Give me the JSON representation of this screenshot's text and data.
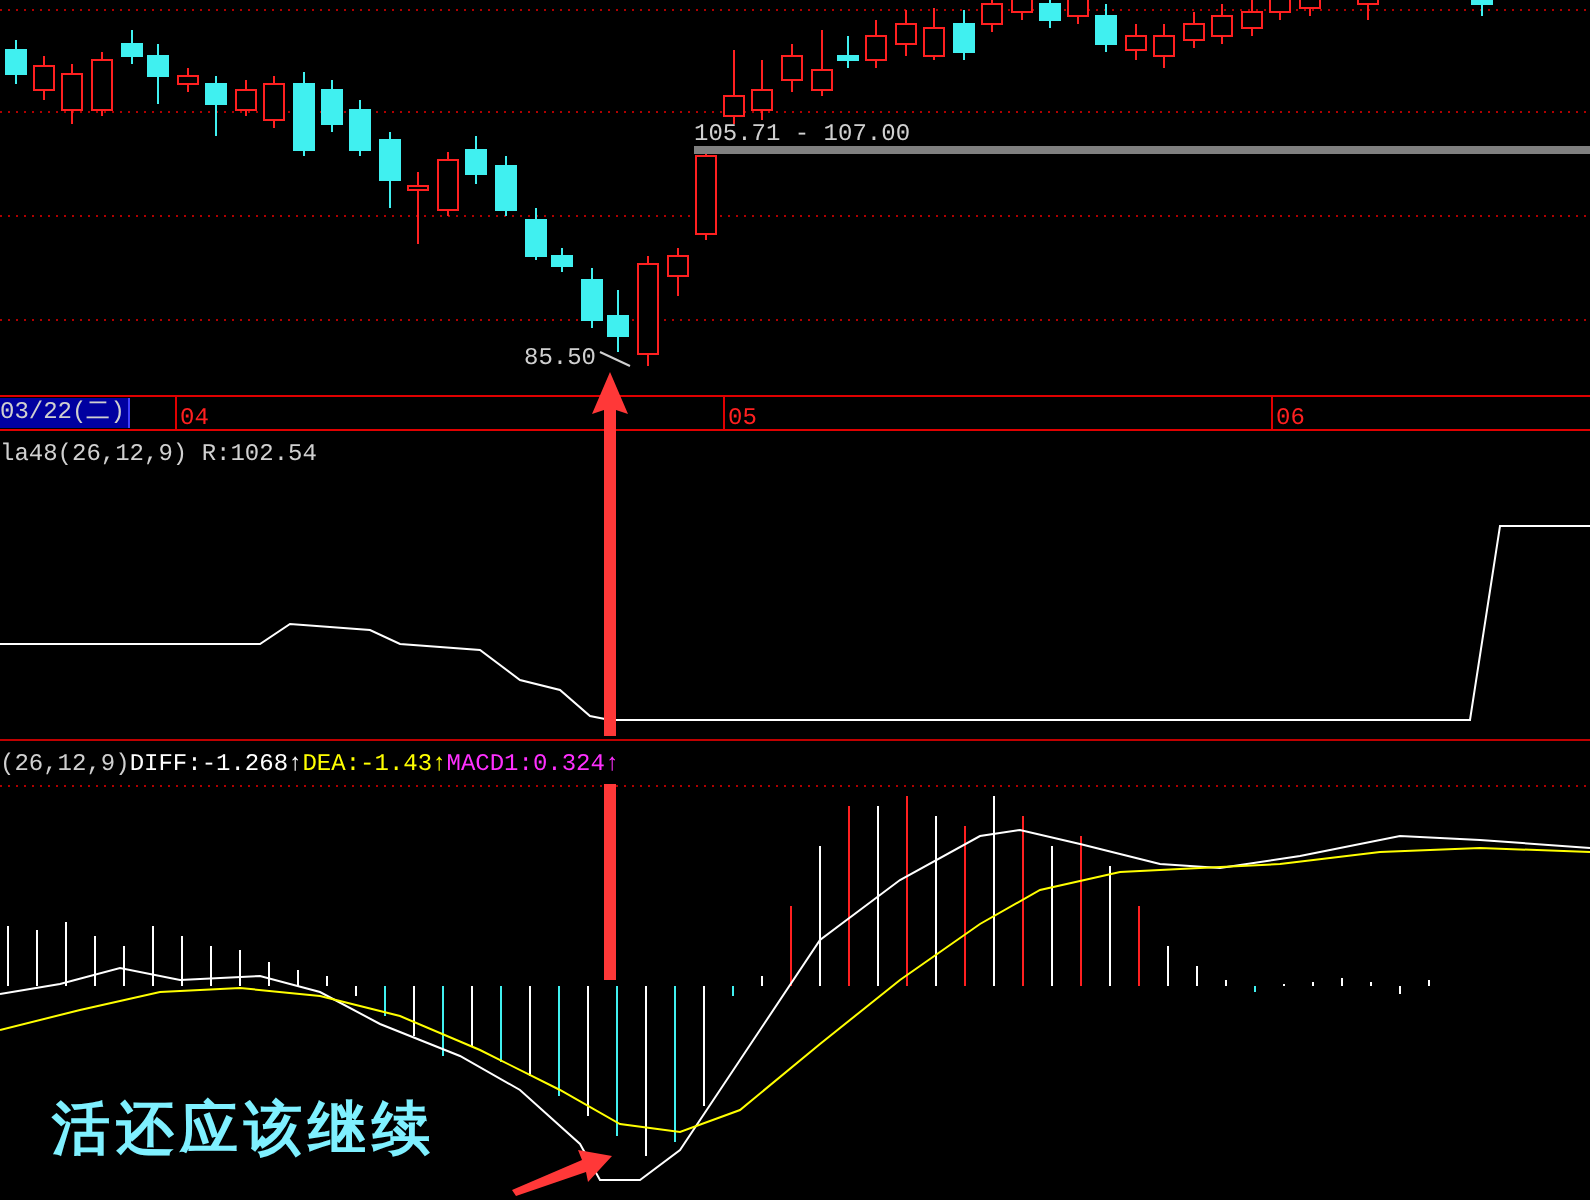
{
  "price_chart": {
    "low_label": "85.50",
    "range_label": "105.71 - 107.00"
  },
  "date_axis": {
    "current_date": "03/22(二)",
    "months": [
      "04",
      "05",
      "06"
    ]
  },
  "indicator_panel": {
    "title": "la48(26,12,9) R:102.54"
  },
  "macd_panel": {
    "params": "(26,12,9)",
    "diff": "DIFF:-1.268↑",
    "dea": "DEA:-1.43↑",
    "macd": "MACD1:0.324↑"
  },
  "caption": "活还应该继续"
}
